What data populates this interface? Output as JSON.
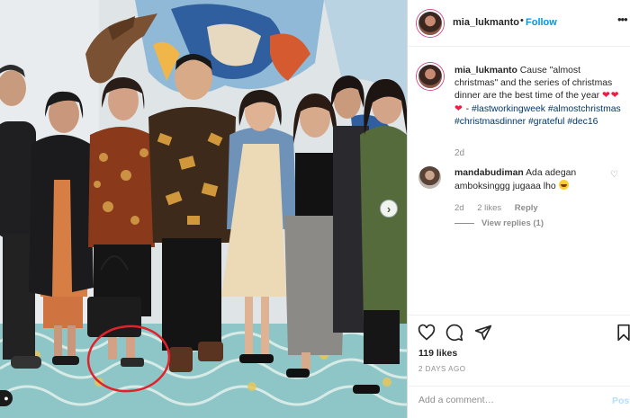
{
  "post": {
    "username": "mia_lukmanto",
    "follow_separator": "•",
    "follow_label": "Follow",
    "more_label": "•••",
    "caption": {
      "username": "mia_lukmanto",
      "text": "Cause \"almost christmas\" and the series of christmas dinner are the best time of the year",
      "hearts": "❤❤❤",
      "dash": " - ",
      "hashtags": [
        "#lastworkingweek",
        "#almostchristmas",
        "#christmasdinner",
        "#grateful",
        "#dec16"
      ],
      "time": "2d"
    },
    "comment": {
      "username": "mandabudiman",
      "text": "Ada adegan amboksinggg jugaaa lho",
      "time": "2d",
      "likes": "2 likes",
      "reply": "Reply",
      "view_replies": "View replies (1)"
    },
    "likes": "119 likes",
    "posted_ago": "2 DAYS AGO",
    "add_comment_placeholder": "Add a comment…",
    "post_label": "Post"
  },
  "photo": {
    "carousel_next": "›",
    "tag_icon": "●"
  },
  "colors": {
    "accent": "#0095f6",
    "heart": "#ed1c45",
    "hashtag": "#00376b",
    "circle_annotation": "#e2222a"
  }
}
